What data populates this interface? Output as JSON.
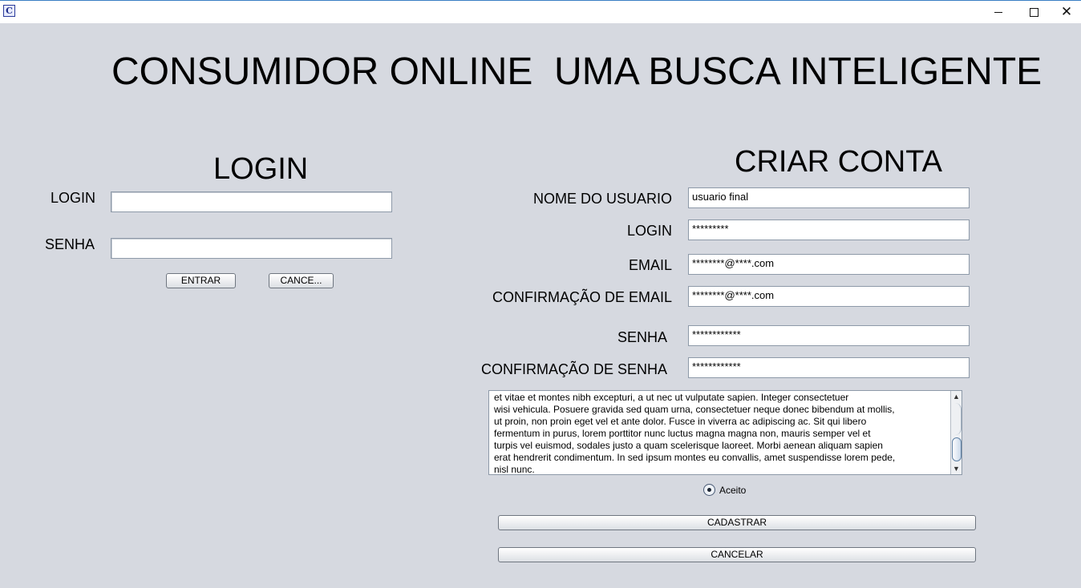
{
  "window": {
    "app_icon": "app-logo-icon",
    "controls": {
      "minimize_icon": "minimize-icon",
      "maximize_icon": "maximize-icon",
      "close_icon": "close-icon"
    }
  },
  "header": {
    "title": "CONSUMIDOR ONLINE  UMA BUSCA INTELIGENTE"
  },
  "login": {
    "heading": "LOGIN",
    "login_label": "LOGIN",
    "login_value": "",
    "senha_label": "SENHA",
    "senha_value": "",
    "enter_button": "ENTRAR",
    "cancel_button": "CANCE..."
  },
  "signup": {
    "heading": "CRIAR CONTA",
    "fields": [
      {
        "label": "NOME DO USUARIO",
        "value": "usuario final"
      },
      {
        "label": "LOGIN",
        "value": "*********"
      },
      {
        "label": "EMAIL",
        "value": "********@****.com"
      },
      {
        "label": "CONFIRMAÇÃO DE EMAIL",
        "value": "********@****.com"
      },
      {
        "label": "SENHA",
        "value": "************"
      },
      {
        "label": "CONFIRMAÇÃO DE SENHA",
        "value": "************"
      }
    ],
    "terms_text": "et vitae et montes nibh excepturi, a ut nec ut vulputate sapien. Integer consectetuer\nwisi vehicula. Posuere gravida sed quam urna, consectetuer neque donec bibendum at mollis,\nut proin, non proin eget vel et ante dolor. Fusce in viverra ac adipiscing ac. Sit qui libero\nfermentum in purus, lorem porttitor nunc luctus magna magna non, mauris semper vel et\nturpis vel euismod, sodales justo a quam scelerisque laoreet. Morbi aenean aliquam sapien\nerat hendrerit condimentum. In sed ipsum montes eu convallis, amet suspendisse lorem pede,\nnisl nunc.",
    "accept_label": "Aceito",
    "accept_selected": true,
    "register_button": "CADASTRAR",
    "cancel_button": "CANCELAR"
  }
}
